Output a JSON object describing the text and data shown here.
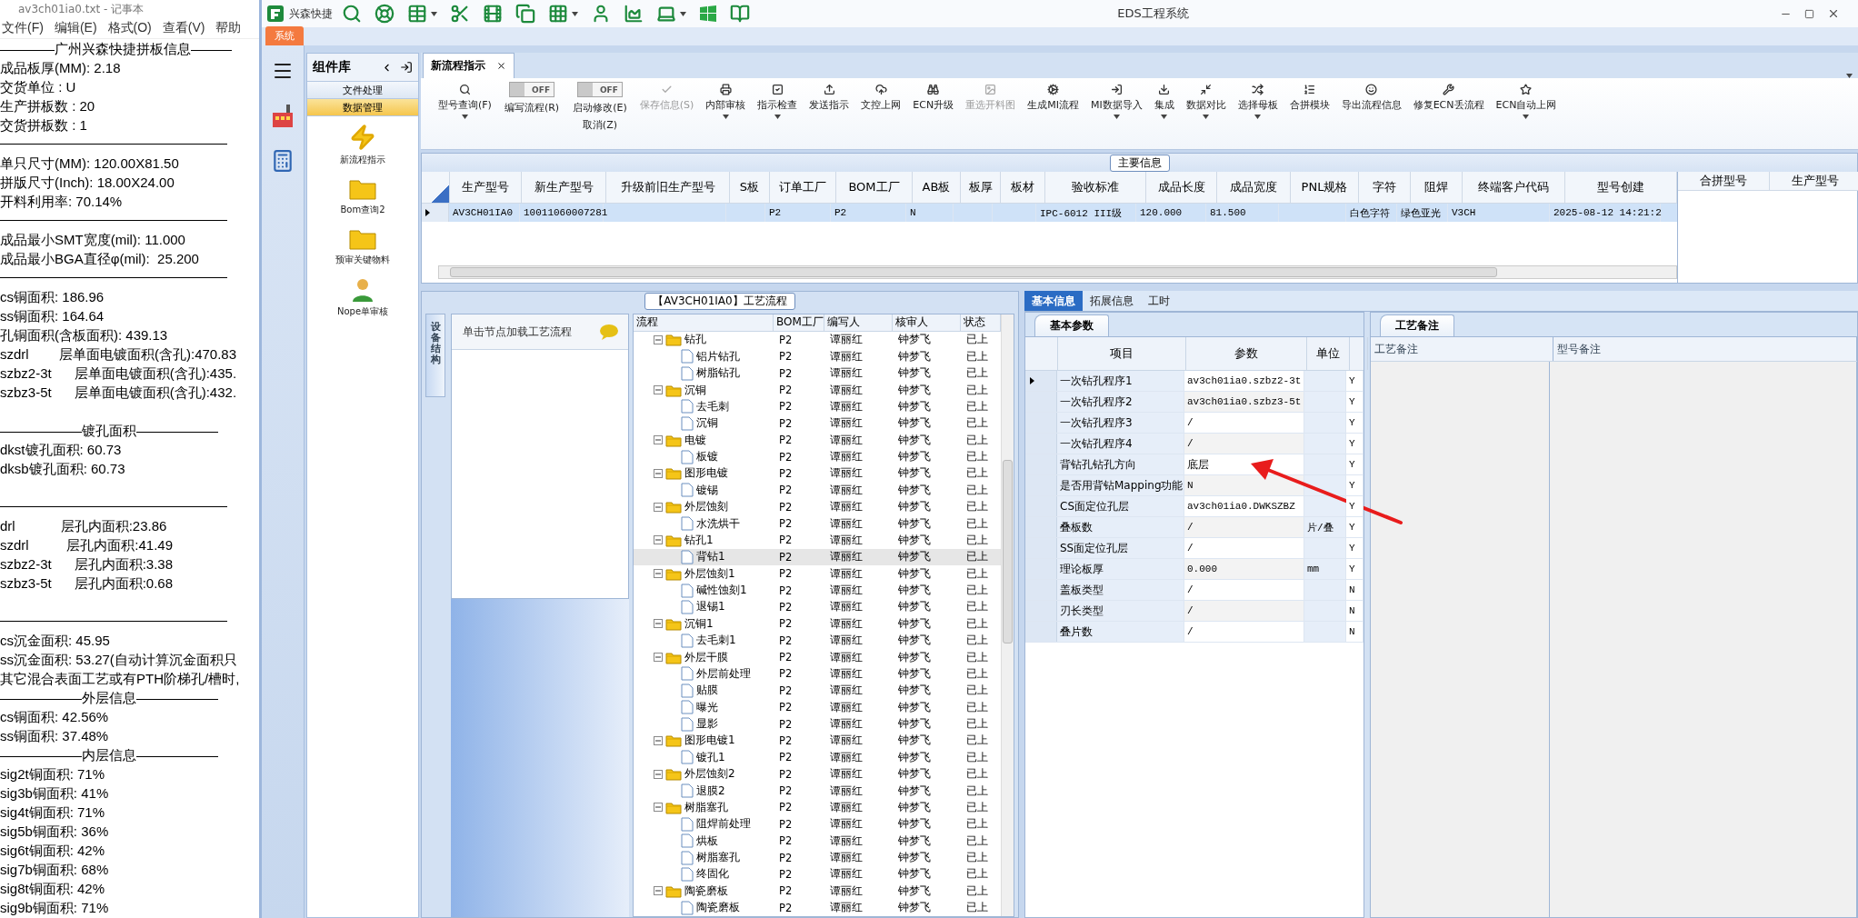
{
  "notepad": {
    "title": "av3ch01ia0.txt - 记事本",
    "menu": [
      "文件(F)",
      "编辑(E)",
      "格式(O)",
      "查看(V)",
      "帮助"
    ],
    "lines": [
      {
        "kind": "text",
        "text": "————广州兴森快捷拼板信息———"
      },
      {
        "kind": "text",
        "text": "成品板厚(MM): 2.18"
      },
      {
        "kind": "text",
        "text": "交货单位 : U"
      },
      {
        "kind": "text",
        "text": "生产拼板数 : 20"
      },
      {
        "kind": "text",
        "text": "交货拼板数 : 1"
      },
      {
        "kind": "rule"
      },
      {
        "kind": "text",
        "text": "单只尺寸(MM): 120.00X81.50"
      },
      {
        "kind": "text",
        "text": "拼版尺寸(Inch): 18.00X24.00"
      },
      {
        "kind": "text",
        "text": "开料利用率: 70.14%"
      },
      {
        "kind": "rule"
      },
      {
        "kind": "text",
        "text": "成品最小SMT宽度(mil): 11.000"
      },
      {
        "kind": "text",
        "text": "成品最小BGA直径φ(mil):  25.200"
      },
      {
        "kind": "rule"
      },
      {
        "kind": "text",
        "text": "cs铜面积: 186.96"
      },
      {
        "kind": "text",
        "text": "ss铜面积: 164.64"
      },
      {
        "kind": "text",
        "text": "孔铜面积(含板面积): 439.13"
      },
      {
        "kind": "text",
        "text": "szdrl        层单面电镀面积(含孔):470.83"
      },
      {
        "kind": "text",
        "text": "szbz2-3t      层单面电镀面积(含孔):435."
      },
      {
        "kind": "text",
        "text": "szbz3-5t      层单面电镀面积(含孔):432."
      },
      {
        "kind": "blank"
      },
      {
        "kind": "text",
        "text": "——————镀孔面积——————"
      },
      {
        "kind": "text",
        "text": "dkst镀孔面积: 60.73"
      },
      {
        "kind": "text",
        "text": "dksb镀孔面积: 60.73"
      },
      {
        "kind": "blank"
      },
      {
        "kind": "rule"
      },
      {
        "kind": "text",
        "text": "drl            层孔内面积:23.86"
      },
      {
        "kind": "text",
        "text": "szdrl          层孔内面积:41.49"
      },
      {
        "kind": "text",
        "text": "szbz2-3t      层孔内面积:3.38"
      },
      {
        "kind": "text",
        "text": "szbz3-5t      层孔内面积:0.68"
      },
      {
        "kind": "blank"
      },
      {
        "kind": "rule"
      },
      {
        "kind": "text",
        "text": "cs沉金面积: 45.95"
      },
      {
        "kind": "text",
        "text": "ss沉金面积: 53.27(自动计算沉金面积只"
      },
      {
        "kind": "text",
        "text": "其它混合表面工艺或有PTH阶梯孔/槽时,"
      },
      {
        "kind": "text",
        "text": "——————外层信息——————"
      },
      {
        "kind": "text",
        "text": "cs铜面积: 42.56%"
      },
      {
        "kind": "text",
        "text": "ss铜面积: 37.48%"
      },
      {
        "kind": "text",
        "text": "——————内层信息——————"
      },
      {
        "kind": "text",
        "text": "sig2t铜面积: 71%"
      },
      {
        "kind": "text",
        "text": "sig3b铜面积: 41%"
      },
      {
        "kind": "text",
        "text": "sig4t铜面积: 71%"
      },
      {
        "kind": "text",
        "text": "sig5b铜面积: 36%"
      },
      {
        "kind": "text",
        "text": "sig6t铜面积: 42%"
      },
      {
        "kind": "text",
        "text": "sig7b铜面积: 68%"
      },
      {
        "kind": "text",
        "text": "sig8t铜面积: 42%"
      },
      {
        "kind": "text",
        "text": "sig9b铜面积: 71%"
      }
    ]
  },
  "app": {
    "brand": "兴森快捷",
    "title": "EDS工程系统",
    "ribbon_tab": "系统"
  },
  "component_library": {
    "title": "组件库",
    "groups": [
      {
        "label": "文件处理",
        "selected": false
      },
      {
        "label": "数据管理",
        "selected": true
      }
    ],
    "items": [
      "新流程指示",
      "Bom查询2",
      "预审关键物料",
      "Nope单审核"
    ]
  },
  "document_tabs": [
    {
      "label": "新流程指示",
      "selected": true
    }
  ],
  "toolbar": [
    {
      "kind": "button",
      "label": "型号查询(F)",
      "dropdown": true,
      "disabled": false
    },
    {
      "kind": "toggle",
      "label": "编写流程(R)",
      "switch_text": "OFF",
      "on": false
    },
    {
      "kind": "toggle",
      "label": "启动修改(E)",
      "second_label": "取消(Z)",
      "switch_text": "OFF",
      "on": false
    },
    {
      "kind": "button",
      "label": "保存信息(S)",
      "dropdown": false,
      "disabled": true
    },
    {
      "kind": "button",
      "label": "内部审核",
      "dropdown": true,
      "disabled": false
    },
    {
      "kind": "button",
      "label": "指示检查",
      "dropdown": true,
      "disabled": false
    },
    {
      "kind": "button",
      "label": "发送指示",
      "dropdown": false,
      "disabled": false
    },
    {
      "kind": "button",
      "label": "文控上网",
      "dropdown": false,
      "disabled": false
    },
    {
      "kind": "button",
      "label": "ECN升级",
      "dropdown": false,
      "disabled": false
    },
    {
      "kind": "button",
      "label": "重选开料图",
      "dropdown": false,
      "disabled": true
    },
    {
      "kind": "button",
      "label": "生成MI流程",
      "dropdown": false,
      "disabled": false
    },
    {
      "kind": "button",
      "label": "MI数据导入",
      "dropdown": true,
      "disabled": false
    },
    {
      "kind": "button",
      "label": "集成",
      "dropdown": true,
      "disabled": false
    },
    {
      "kind": "button",
      "label": "数据对比",
      "dropdown": true,
      "disabled": false
    },
    {
      "kind": "button",
      "label": "选择母板",
      "dropdown": true,
      "disabled": false
    },
    {
      "kind": "button",
      "label": "合拼模块",
      "dropdown": false,
      "disabled": false
    },
    {
      "kind": "button",
      "label": "导出流程信息",
      "dropdown": false,
      "disabled": false
    },
    {
      "kind": "button",
      "label": "修复ECN丢流程",
      "dropdown": false,
      "disabled": false
    },
    {
      "kind": "button",
      "label": "ECN自动上网",
      "dropdown": true,
      "disabled": false
    }
  ],
  "main_info": {
    "title": "主要信息",
    "columns": [
      "生产型号",
      "新生产型号",
      "升级前旧生产型号",
      "S板",
      "订单工厂",
      "BOM工厂",
      "AB板",
      "板厚",
      "板材",
      "验收标准",
      "成品长度",
      "成品宽度",
      "PNL规格",
      "字符",
      "阻焊",
      "终端客户代码",
      "型号创建"
    ],
    "rows": [
      {
        "selected": true,
        "cells": [
          "AV3CH01IA0",
          "10011060007281",
          null,
          null,
          "P2",
          "P2",
          "N",
          null,
          null,
          "IPC-6012 III级",
          "120.000",
          "81.500",
          null,
          "白色字符",
          "绿色亚光",
          "V3CH",
          "2025-08-12 14:21:2"
        ]
      }
    ],
    "side_columns": [
      "合拼型号",
      "生产型号"
    ]
  },
  "process": {
    "title": "【AV3CH01IA0】工艺流程",
    "side_tab": "设备结构",
    "hint": "单击节点加载工艺流程",
    "columns": [
      "流程",
      "BOM工厂",
      "编写人",
      "核审人",
      "状态"
    ],
    "tree": [
      {
        "name": "钻孔",
        "bom_factory": "P2",
        "writer": "谭丽红",
        "reviewer": "钟梦飞",
        "status": "已上",
        "selected": false,
        "expanded": true,
        "children": [
          {
            "name": "铝片钻孔",
            "bom_factory": "P2",
            "writer": "谭丽红",
            "reviewer": "钟梦飞",
            "status": "已上",
            "selected": false
          },
          {
            "name": "树脂钻孔",
            "bom_factory": "P2",
            "writer": "谭丽红",
            "reviewer": "钟梦飞",
            "status": "已上",
            "selected": false
          }
        ]
      },
      {
        "name": "沉铜",
        "bom_factory": "P2",
        "writer": "谭丽红",
        "reviewer": "钟梦飞",
        "status": "已上",
        "selected": false,
        "expanded": true,
        "children": [
          {
            "name": "去毛刺",
            "bom_factory": "P2",
            "writer": "谭丽红",
            "reviewer": "钟梦飞",
            "status": "已上",
            "selected": false
          },
          {
            "name": "沉铜",
            "bom_factory": "P2",
            "writer": "谭丽红",
            "reviewer": "钟梦飞",
            "status": "已上",
            "selected": false
          }
        ]
      },
      {
        "name": "电镀",
        "bom_factory": "P2",
        "writer": "谭丽红",
        "reviewer": "钟梦飞",
        "status": "已上",
        "selected": false,
        "expanded": true,
        "children": [
          {
            "name": "板镀",
            "bom_factory": "P2",
            "writer": "谭丽红",
            "reviewer": "钟梦飞",
            "status": "已上",
            "selected": false
          }
        ]
      },
      {
        "name": "图形电镀",
        "bom_factory": "P2",
        "writer": "谭丽红",
        "reviewer": "钟梦飞",
        "status": "已上",
        "selected": false,
        "expanded": true,
        "children": [
          {
            "name": "镀锡",
            "bom_factory": "P2",
            "writer": "谭丽红",
            "reviewer": "钟梦飞",
            "status": "已上",
            "selected": false
          }
        ]
      },
      {
        "name": "外层蚀刻",
        "bom_factory": "P2",
        "writer": "谭丽红",
        "reviewer": "钟梦飞",
        "status": "已上",
        "selected": false,
        "expanded": true,
        "children": [
          {
            "name": "水洗烘干",
            "bom_factory": "P2",
            "writer": "谭丽红",
            "reviewer": "钟梦飞",
            "status": "已上",
            "selected": false
          }
        ]
      },
      {
        "name": "钻孔1",
        "bom_factory": "P2",
        "writer": "谭丽红",
        "reviewer": "钟梦飞",
        "status": "已上",
        "selected": false,
        "expanded": true,
        "children": [
          {
            "name": "背钻1",
            "bom_factory": "P2",
            "writer": "谭丽红",
            "reviewer": "钟梦飞",
            "status": "已上",
            "selected": true
          }
        ]
      },
      {
        "name": "外层蚀刻1",
        "bom_factory": "P2",
        "writer": "谭丽红",
        "reviewer": "钟梦飞",
        "status": "已上",
        "selected": false,
        "expanded": true,
        "children": [
          {
            "name": "碱性蚀刻1",
            "bom_factory": "P2",
            "writer": "谭丽红",
            "reviewer": "钟梦飞",
            "status": "已上",
            "selected": false
          },
          {
            "name": "退锡1",
            "bom_factory": "P2",
            "writer": "谭丽红",
            "reviewer": "钟梦飞",
            "status": "已上",
            "selected": false
          }
        ]
      },
      {
        "name": "沉铜1",
        "bom_factory": "P2",
        "writer": "谭丽红",
        "reviewer": "钟梦飞",
        "status": "已上",
        "selected": false,
        "expanded": true,
        "children": [
          {
            "name": "去毛刺1",
            "bom_factory": "P2",
            "writer": "谭丽红",
            "reviewer": "钟梦飞",
            "status": "已上",
            "selected": false
          }
        ]
      },
      {
        "name": "外层干膜",
        "bom_factory": "P2",
        "writer": "谭丽红",
        "reviewer": "钟梦飞",
        "status": "已上",
        "selected": false,
        "expanded": true,
        "children": [
          {
            "name": "外层前处理",
            "bom_factory": "P2",
            "writer": "谭丽红",
            "reviewer": "钟梦飞",
            "status": "已上",
            "selected": false
          },
          {
            "name": "贴膜",
            "bom_factory": "P2",
            "writer": "谭丽红",
            "reviewer": "钟梦飞",
            "status": "已上",
            "selected": false
          },
          {
            "name": "曝光",
            "bom_factory": "P2",
            "writer": "谭丽红",
            "reviewer": "钟梦飞",
            "status": "已上",
            "selected": false
          },
          {
            "name": "显影",
            "bom_factory": "P2",
            "writer": "谭丽红",
            "reviewer": "钟梦飞",
            "status": "已上",
            "selected": false
          }
        ]
      },
      {
        "name": "图形电镀1",
        "bom_factory": "P2",
        "writer": "谭丽红",
        "reviewer": "钟梦飞",
        "status": "已上",
        "selected": false,
        "expanded": true,
        "children": [
          {
            "name": "镀孔1",
            "bom_factory": "P2",
            "writer": "谭丽红",
            "reviewer": "钟梦飞",
            "status": "已上",
            "selected": false
          }
        ]
      },
      {
        "name": "外层蚀刻2",
        "bom_factory": "P2",
        "writer": "谭丽红",
        "reviewer": "钟梦飞",
        "status": "已上",
        "selected": false,
        "expanded": true,
        "children": [
          {
            "name": "退膜2",
            "bom_factory": "P2",
            "writer": "谭丽红",
            "reviewer": "钟梦飞",
            "status": "已上",
            "selected": false
          }
        ]
      },
      {
        "name": "树脂塞孔",
        "bom_factory": "P2",
        "writer": "谭丽红",
        "reviewer": "钟梦飞",
        "status": "已上",
        "selected": false,
        "expanded": true,
        "children": [
          {
            "name": "阻焊前处理",
            "bom_factory": "P2",
            "writer": "谭丽红",
            "reviewer": "钟梦飞",
            "status": "已上",
            "selected": false
          },
          {
            "name": "烘板",
            "bom_factory": "P2",
            "writer": "谭丽红",
            "reviewer": "钟梦飞",
            "status": "已上",
            "selected": false
          },
          {
            "name": "树脂塞孔",
            "bom_factory": "P2",
            "writer": "谭丽红",
            "reviewer": "钟梦飞",
            "status": "已上",
            "selected": false
          },
          {
            "name": "终固化",
            "bom_factory": "P2",
            "writer": "谭丽红",
            "reviewer": "钟梦飞",
            "status": "已上",
            "selected": false
          }
        ]
      },
      {
        "name": "陶瓷磨板",
        "bom_factory": "P2",
        "writer": "谭丽红",
        "reviewer": "钟梦飞",
        "status": "已上",
        "selected": false,
        "expanded": true,
        "children": [
          {
            "name": "陶瓷磨板",
            "bom_factory": "P2",
            "writer": "谭丽红",
            "reviewer": "钟梦飞",
            "status": "已上",
            "selected": false
          }
        ]
      }
    ]
  },
  "details": {
    "tabs": [
      {
        "label": "基本信息",
        "selected": true
      },
      {
        "label": "拓展信息",
        "selected": false
      },
      {
        "label": "工时",
        "selected": false
      }
    ],
    "sub_tab": "基本参数",
    "columns": [
      "项目",
      "参数",
      "单位"
    ],
    "rows": [
      {
        "item": "一次钻孔程序1",
        "value": "av3ch01ia0.szbz2-3t",
        "column_4": "Y",
        "selected": true
      },
      {
        "item": "一次钻孔程序2",
        "value": "av3ch01ia0.szbz3-5t",
        "column_4": "Y",
        "selected": false
      },
      {
        "item": "一次钻孔程序3",
        "value": "/",
        "column_4": "Y",
        "selected": false
      },
      {
        "item": "一次钻孔程序4",
        "value": "/",
        "column_4": "Y",
        "selected": false
      },
      {
        "item": "背钻孔钻孔方向",
        "value": "底层",
        "column_4": "Y",
        "selected": false
      },
      {
        "item": "是否用背钻Mapping功能",
        "value": "N",
        "column_4": "Y",
        "selected": false
      },
      {
        "item": "CS面定位孔层",
        "value": "av3ch01ia0.DWKSZBZ",
        "column_4": "Y",
        "selected": false
      },
      {
        "item": "叠板数",
        "value": "/",
        "unit": "片/叠",
        "column_4": "Y",
        "selected": false
      },
      {
        "item": "SS面定位孔层",
        "value": "/",
        "column_4": "Y",
        "selected": false
      },
      {
        "item": "理论板厚",
        "value": "0.000",
        "unit": "mm",
        "column_4": "Y",
        "selected": false
      },
      {
        "item": "盖板类型",
        "value": "/",
        "column_4": "N",
        "selected": false
      },
      {
        "item": "刃长类型",
        "value": "/",
        "column_4": "N",
        "selected": false
      },
      {
        "item": "叠片数",
        "value": "/",
        "column_4": "N",
        "selected": false
      }
    ]
  },
  "remarks": {
    "tab": "工艺备注",
    "columns": [
      "工艺备注",
      "型号备注"
    ]
  }
}
